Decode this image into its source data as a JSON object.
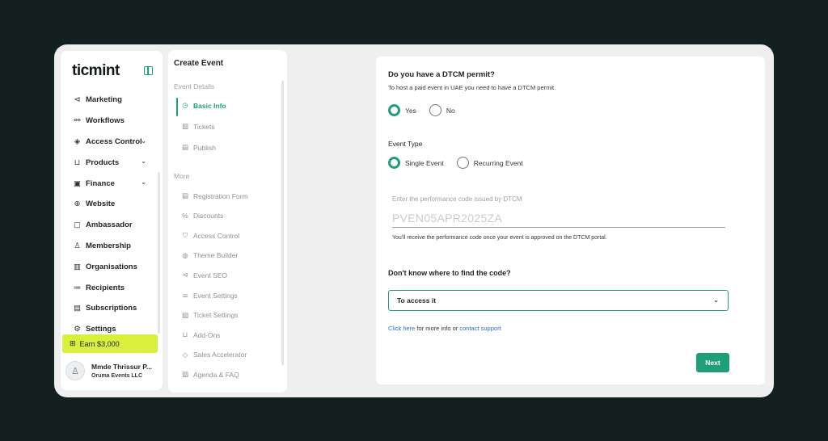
{
  "brand": {
    "logo": "ticmint"
  },
  "sidebar": {
    "items": [
      {
        "label": "Marketing",
        "icon": "megaphone-icon",
        "glyph": "⊲",
        "expandable": false
      },
      {
        "label": "Workflows",
        "icon": "workflow-icon",
        "glyph": "⚯",
        "expandable": false
      },
      {
        "label": "Access Control",
        "icon": "access-control-icon",
        "glyph": "◈",
        "expandable": true
      },
      {
        "label": "Products",
        "icon": "cart-icon",
        "glyph": "⊔",
        "expandable": true
      },
      {
        "label": "Finance",
        "icon": "wallet-icon",
        "glyph": "▣",
        "expandable": true
      },
      {
        "label": "Website",
        "icon": "globe-icon",
        "glyph": "⊕",
        "expandable": false
      },
      {
        "label": "Ambassador",
        "icon": "ambassador-icon",
        "glyph": "▢",
        "expandable": false
      },
      {
        "label": "Membership",
        "icon": "membership-icon",
        "glyph": "♙",
        "expandable": false
      },
      {
        "label": "Organisations",
        "icon": "building-icon",
        "glyph": "▥",
        "expandable": false
      },
      {
        "label": "Recipients",
        "icon": "list-icon",
        "glyph": "≔",
        "expandable": false
      },
      {
        "label": "Subscriptions",
        "icon": "subscriptions-icon",
        "glyph": "▤",
        "expandable": false
      },
      {
        "label": "Settings",
        "icon": "gear-icon",
        "glyph": "⚙",
        "expandable": false
      }
    ],
    "earn_label": "Earn $3,000",
    "user": {
      "name": "Mmde Thrissur P...",
      "company": "Oruma Events LLC"
    }
  },
  "steps": {
    "title": "Create Event",
    "section1": "Event Details",
    "section1_items": [
      {
        "label": "Basic Info",
        "icon": "clock-icon",
        "glyph": "◷",
        "active": true
      },
      {
        "label": "Tickets",
        "icon": "ticket-icon",
        "glyph": "▧",
        "active": false
      },
      {
        "label": "Publish",
        "icon": "document-icon",
        "glyph": "▤",
        "active": false
      }
    ],
    "section2": "More",
    "section2_items": [
      {
        "label": "Registration Form",
        "icon": "form-icon",
        "glyph": "▤"
      },
      {
        "label": "Discounts",
        "icon": "percent-icon",
        "glyph": "%"
      },
      {
        "label": "Access Control",
        "icon": "shield-icon",
        "glyph": "⛉"
      },
      {
        "label": "Theme Builder",
        "icon": "palette-icon",
        "glyph": "◍"
      },
      {
        "label": "Event SEO",
        "icon": "megaphone-icon",
        "glyph": "⊲"
      },
      {
        "label": "Event Settings",
        "icon": "sliders-icon",
        "glyph": "⚌"
      },
      {
        "label": "Ticket Settings",
        "icon": "ticket-settings-icon",
        "glyph": "▧"
      },
      {
        "label": "Add-Ons",
        "icon": "cart-icon",
        "glyph": "⊔"
      },
      {
        "label": "Sales Accelerator",
        "icon": "tag-icon",
        "glyph": "◇"
      },
      {
        "label": "Agenda & FAQ",
        "icon": "agenda-icon",
        "glyph": "▨"
      }
    ]
  },
  "form": {
    "permit_question": "Do you have a DTCM permit?",
    "permit_sub": "To host a paid event in UAE you need to have a DTCM permit.",
    "permit_yes": "Yes",
    "permit_no": "No",
    "event_type_label": "Event Type",
    "event_type_single": "Single Event",
    "event_type_recurring": "Recurring Event",
    "perf_label": "Enter the performance code issued by DTCM",
    "perf_placeholder": "PVEN05APR2025ZA",
    "perf_value": "",
    "perf_note": "You'll receive the performance code once your event is approved on the DTCM portal.",
    "dont_know": "Don't know where to find the code?",
    "select_value": "To access it",
    "help_link1": "Click here",
    "help_text": " for more info or ",
    "help_link2": "contact support",
    "next_label": "Next"
  },
  "colors": {
    "accent": "#1f9e7a",
    "earn_bg": "#d8ef3c",
    "link": "#2a6fd6",
    "page_bg": "#13201f"
  }
}
